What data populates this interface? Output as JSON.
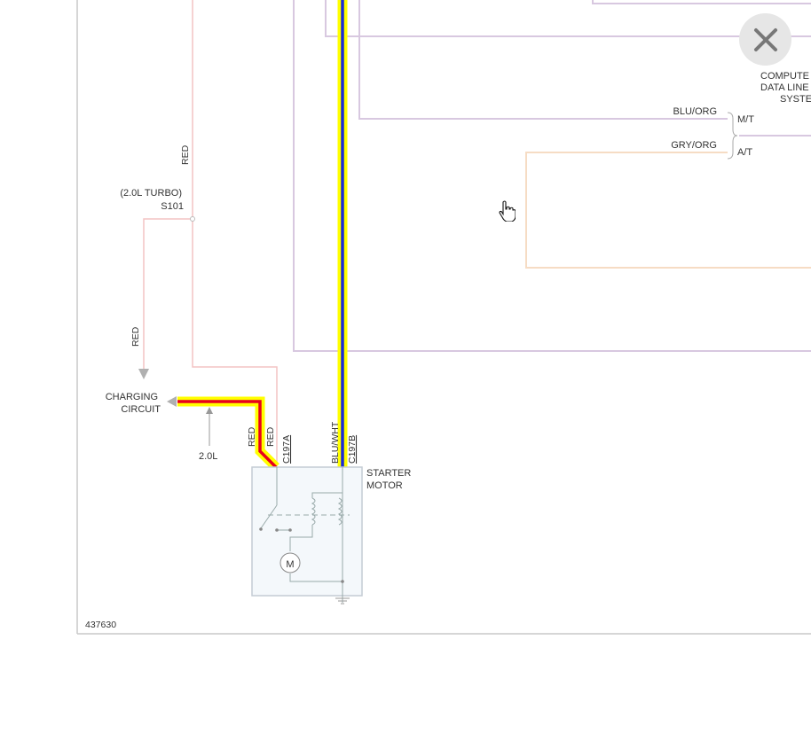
{
  "diagram_id": "437630",
  "close_button_label": "close",
  "labels": {
    "red_vertical_top": "RED",
    "turbo_note": "(2.0L TURBO)",
    "splice": "S101",
    "red_vertical_left": "RED",
    "charging_line1": "CHARGING",
    "charging_line2": "CIRCUIT",
    "engine_note": "2.0L",
    "wire_red_1": "RED",
    "wire_red_2": "RED",
    "connector_a": "C197A",
    "wire_blu_wht": "BLU/WHT",
    "connector_b": "C197B",
    "starter_line1": "STARTER",
    "starter_line2": "MOTOR",
    "wire_blu_org": "BLU/ORG",
    "wire_gry_org": "GRY/ORG",
    "trans_mt": "M/T",
    "trans_at": "A/T",
    "computer_line1": "COMPUTE",
    "computer_line2": "DATA LINE",
    "computer_line3": "SYSTE",
    "motor_symbol": "M"
  },
  "colors": {
    "highlight_yellow": "#ffff00",
    "wire_red": "#e8001c",
    "wire_blue": "#1a2bd6",
    "faded_red": "#f4c4c4",
    "faded_purple": "#d8c8e0",
    "faded_orange": "#f6dcc4",
    "component_fill": "#f4f8fb",
    "border_gray": "#c8c8c8"
  },
  "icons": {
    "close": "close-icon",
    "cursor": "hand-pointer-icon",
    "ground": "ground-icon"
  }
}
